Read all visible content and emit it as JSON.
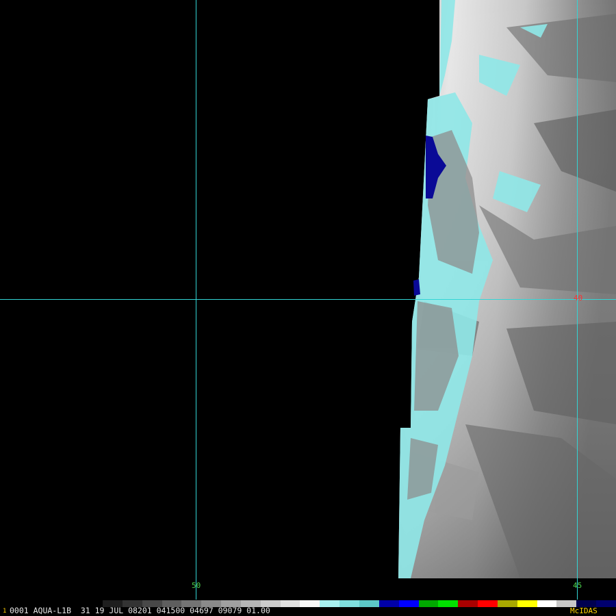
{
  "image": {
    "footer_text": "0001 AQUA-L1B  31 19 JUL 08201 041500 04697 09079 01.00",
    "frame_marker": "1",
    "brand": "McIDAS",
    "grid_labels": {
      "lon_50": "50",
      "lon_45": "45",
      "lat_40": "40"
    },
    "colors": {
      "grid": "#33d6d6",
      "lon_label": "#4cd24c",
      "lat_label": "#ff3030",
      "brand": "#ffd400",
      "cold_cloud": "#8fe8e8",
      "deep_convection": "#0a0a96"
    },
    "colorbar": [
      "#1e1e1e",
      "#333333",
      "#484848",
      "#5e5e5e",
      "#747474",
      "#8a8a8a",
      "#a0a0a0",
      "#b6b6b6",
      "#cccccc",
      "#e2e2e2",
      "#f8f8f8",
      "#a8f0f0",
      "#7fdede",
      "#5cc8c8",
      "#0000a8",
      "#0000ff",
      "#00a800",
      "#00e000",
      "#a80000",
      "#ff0000",
      "#a8a800",
      "#ffff00",
      "#ffffff",
      "#c8c8c8",
      "#000050",
      "#00006e"
    ]
  }
}
